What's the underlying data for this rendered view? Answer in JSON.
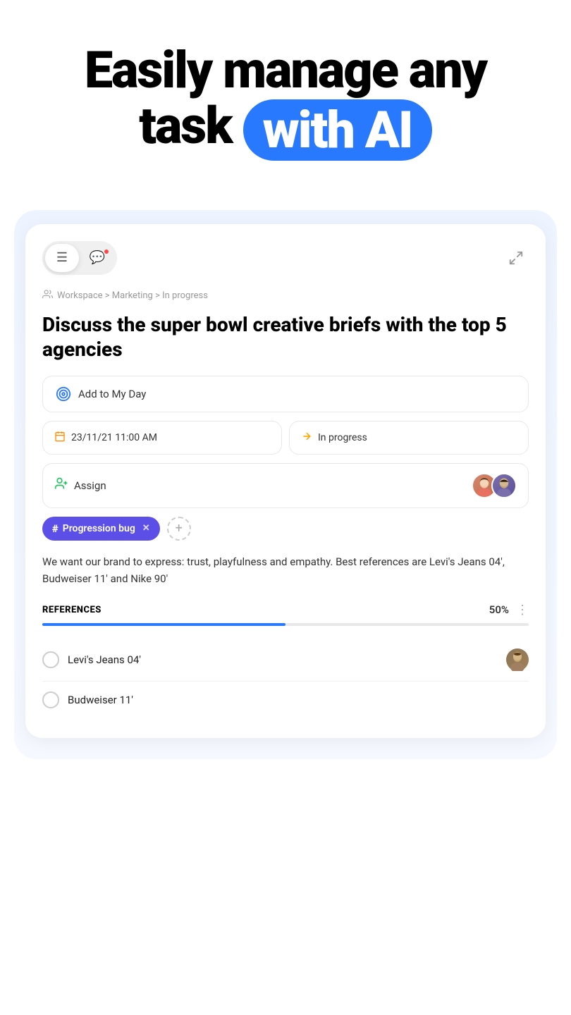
{
  "hero": {
    "line1": "Easily manage any",
    "line2_prefix": "task ",
    "line2_highlight": "with AI"
  },
  "toolbar": {
    "tab_detail_icon": "☰",
    "tab_chat_icon": "💬",
    "expand_icon": "⤢",
    "has_notification": true
  },
  "breadcrumb": {
    "icon": "👤",
    "path": "Workspace > Marketing > In progress"
  },
  "task": {
    "title": "Discuss the super bowl creative briefs with the top 5 agencies",
    "add_to_my_day": "Add to My Day",
    "date": "23/11/21 11:00 AM",
    "status": "In progress",
    "assign_label": "Assign",
    "tag_name": "Progression bug",
    "description": "We want our brand to express: trust, playfulness and empathy. Best references are Levi's Jeans 04', Budweiser 11' and Nike 90'"
  },
  "references": {
    "title": "REFERENCES",
    "percent": "50%",
    "progress": 50,
    "items": [
      {
        "label": "Levi's Jeans 04'"
      },
      {
        "label": "Budweiser 11'"
      }
    ]
  }
}
